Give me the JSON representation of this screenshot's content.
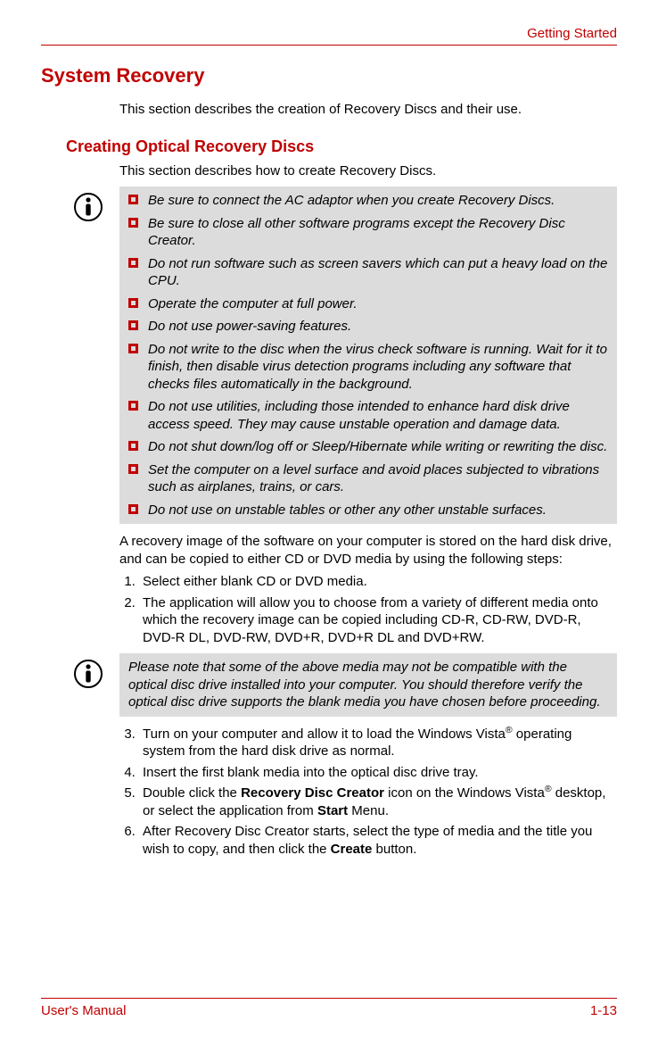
{
  "header": {
    "running_title": "Getting Started"
  },
  "headings": {
    "h1": "System Recovery",
    "h2": "Creating Optical Recovery Discs"
  },
  "intro": "This section describes the creation of Recovery Discs and their use.",
  "sub_intro": "This section describes how to create Recovery Discs.",
  "note1": {
    "items": [
      "Be sure to connect the AC adaptor when you create Recovery Discs.",
      "Be sure to close all other software programs except the Recovery Disc Creator.",
      "Do not run software such as screen savers which can put a heavy load on the CPU.",
      "Operate the computer at full power.",
      "Do not use power-saving features.",
      "Do not write to the disc when the virus check software is running. Wait for it to finish, then disable virus detection programs including any software that checks files automatically in the background.",
      "Do not use utilities, including those intended to enhance hard disk drive access speed. They may cause unstable operation and damage data.",
      "Do not shut down/log off or Sleep/Hibernate while writing or rewriting the disc.",
      "Set the computer on a level surface and avoid places subjected to vibrations such as airplanes, trains, or cars.",
      "Do not use on unstable tables or other any other unstable surfaces."
    ]
  },
  "after_note_para": "A recovery image of the software on your computer is stored on the hard disk drive, and can be copied to either CD or DVD media by using the following steps:",
  "steps_a": {
    "s1": "Select either blank CD or DVD media.",
    "s2": "The application will allow you to choose from a variety of different media onto which the recovery image can be copied including CD-R, CD-RW, DVD-R, DVD-R DL, DVD-RW, DVD+R, DVD+R DL and DVD+RW."
  },
  "note2": "Please note that some of the above media may not be compatible with the optical disc drive installed into your computer. You should therefore verify the optical disc drive supports the blank media you have chosen before proceeding.",
  "steps_b": {
    "s3_pre": "Turn on your computer and allow it to load the Windows Vista",
    "s3_post": " operating system from the hard disk drive as normal.",
    "s4": "Insert the first blank media into the optical disc drive tray.",
    "s5_a": "Double click the ",
    "s5_b": "Recovery Disc Creator",
    "s5_c": " icon on the Windows Vista",
    "s5_d": " desktop, or select the application from ",
    "s5_e": "Start",
    "s5_f": " Menu.",
    "s6_a": "After Recovery Disc Creator starts, select the type of media and the title you wish to copy, and then click the ",
    "s6_b": "Create",
    "s6_c": " button."
  },
  "footer": {
    "left": "User's Manual",
    "right": "1-13"
  },
  "glyphs": {
    "reg": "®"
  }
}
